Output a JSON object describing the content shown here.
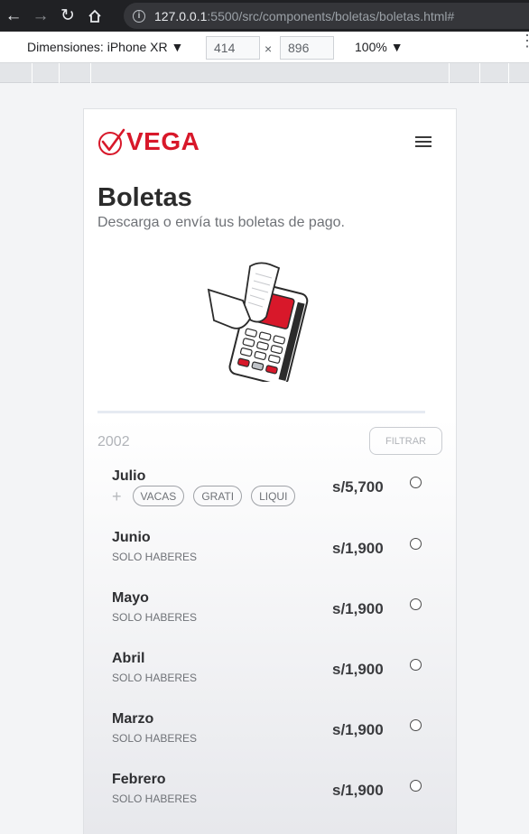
{
  "browser": {
    "url_host": "127.0.0.1",
    "url_rest": ":5500/src/components/boletas/boletas.html#",
    "device_label": "Dimensiones: iPhone XR ▼",
    "width_value": "414",
    "height_value": "896",
    "times": "×",
    "zoom": "100% ▼"
  },
  "app": {
    "brand": "VEGA",
    "title": "Boletas",
    "subtitle": "Descarga o envía tus boletas de pago.",
    "year": "2002",
    "filter_label": "FILTRAR"
  },
  "colors": {
    "brand_red": "#d8182a"
  },
  "payslips": [
    {
      "month": "Julio",
      "tags": [
        "VACAS",
        "GRATI",
        "LIQUI"
      ],
      "plus": "+",
      "amount": "s/5,700"
    },
    {
      "month": "Junio",
      "note": "SOLO HABERES",
      "amount": "s/1,900"
    },
    {
      "month": "Mayo",
      "note": "SOLO HABERES",
      "amount": "s/1,900"
    },
    {
      "month": "Abril",
      "note": "SOLO HABERES",
      "amount": "s/1,900"
    },
    {
      "month": "Marzo",
      "note": "SOLO HABERES",
      "amount": "s/1,900"
    },
    {
      "month": "Febrero",
      "note": "SOLO HABERES",
      "amount": "s/1,900"
    }
  ]
}
